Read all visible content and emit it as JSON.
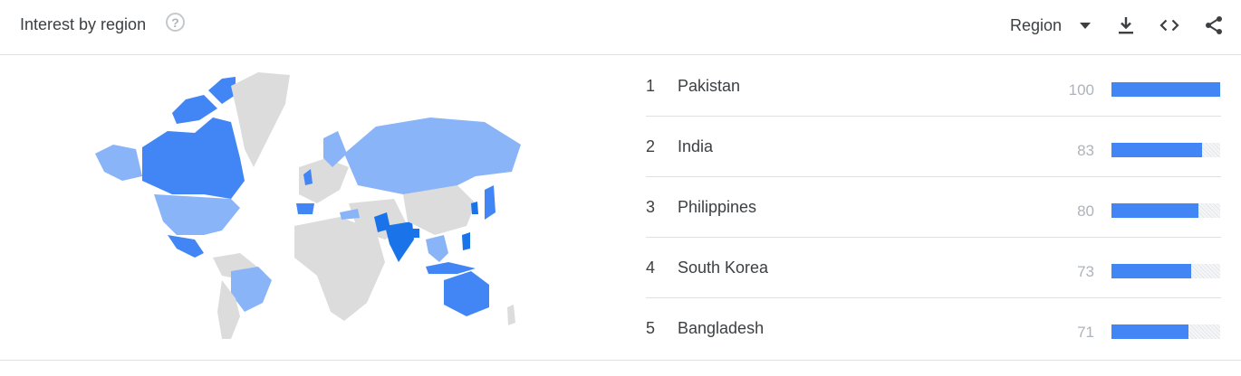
{
  "header": {
    "title": "Interest by region",
    "help_icon": "?",
    "region_label": "Region",
    "icons": [
      "download-icon",
      "embed-icon",
      "share-icon"
    ]
  },
  "colors": {
    "bar": "#4285f4",
    "map_dark": "#1a73e8",
    "map_mid": "#4285f4",
    "map_light": "#8ab4f8",
    "map_none": "#dcdcdc"
  },
  "regions": [
    {
      "rank": "1",
      "name": "Pakistan",
      "value": "100",
      "level": 100
    },
    {
      "rank": "2",
      "name": "India",
      "value": "83",
      "level": 83
    },
    {
      "rank": "3",
      "name": "Philippines",
      "value": "80",
      "level": 80
    },
    {
      "rank": "4",
      "name": "South Korea",
      "value": "73",
      "level": 73
    },
    {
      "rank": "5",
      "name": "Bangladesh",
      "value": "71",
      "level": 71
    }
  ]
}
